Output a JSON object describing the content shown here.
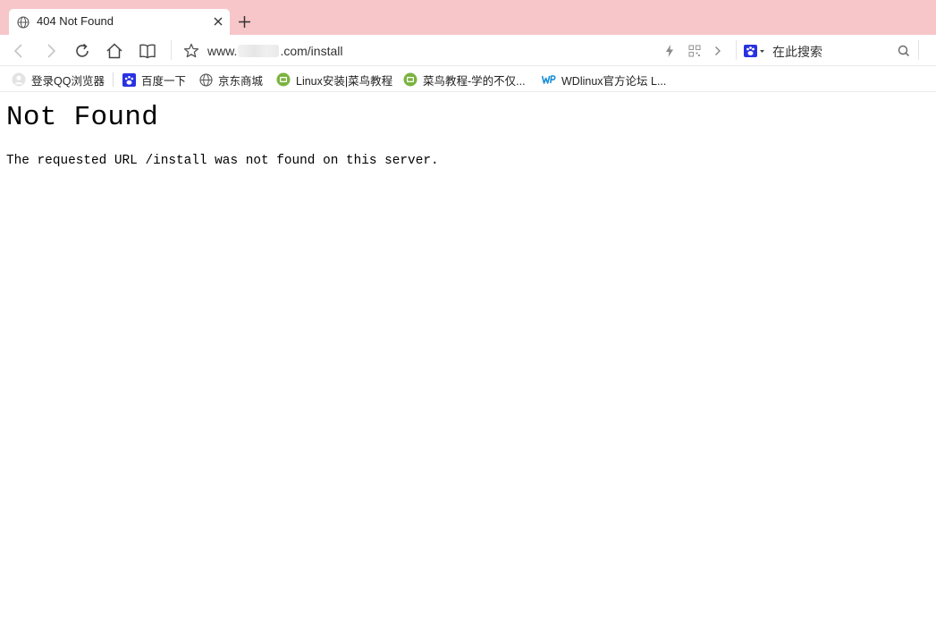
{
  "tab": {
    "title": "404 Not Found"
  },
  "navbar": {
    "url_prefix": "www.",
    "url_suffix": ".com/install",
    "search_placeholder": "在此搜索"
  },
  "bookmarks": [
    {
      "label": "登录QQ浏览器",
      "icon": "user-avatar-icon"
    },
    {
      "label": "百度一下",
      "icon": "baidu-paw-icon"
    },
    {
      "label": "京东商城",
      "icon": "globe-icon"
    },
    {
      "label": "Linux安装|菜鸟教程",
      "icon": "runoob-icon"
    },
    {
      "label": "菜鸟教程-学的不仅...",
      "icon": "runoob-icon"
    },
    {
      "label": "WDlinux官方论坛 L...",
      "icon": "wdlinux-icon"
    }
  ],
  "page": {
    "heading": "Not Found",
    "message": "The requested URL /install was not found on this server."
  },
  "colors": {
    "tabstrip_bg": "#f7c6c9",
    "baidu_blue": "#2932e1",
    "runoob_green": "#7cb342",
    "wdlinux_blue": "#1a8fd8"
  }
}
